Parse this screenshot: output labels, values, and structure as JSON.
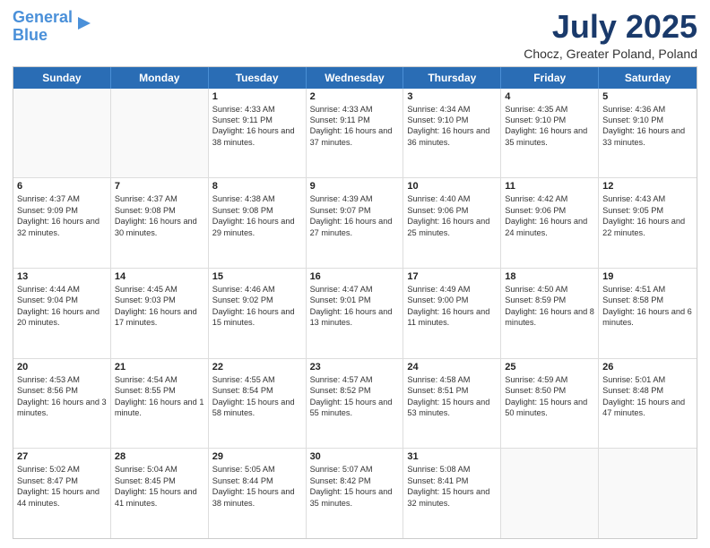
{
  "header": {
    "logo_line1": "General",
    "logo_line2": "Blue",
    "month_year": "July 2025",
    "location": "Chocz, Greater Poland, Poland"
  },
  "weekdays": [
    "Sunday",
    "Monday",
    "Tuesday",
    "Wednesday",
    "Thursday",
    "Friday",
    "Saturday"
  ],
  "rows": [
    [
      {
        "day": "",
        "sunrise": "",
        "sunset": "",
        "daylight": "",
        "empty": true
      },
      {
        "day": "",
        "sunrise": "",
        "sunset": "",
        "daylight": "",
        "empty": true
      },
      {
        "day": "1",
        "sunrise": "Sunrise: 4:33 AM",
        "sunset": "Sunset: 9:11 PM",
        "daylight": "Daylight: 16 hours and 38 minutes."
      },
      {
        "day": "2",
        "sunrise": "Sunrise: 4:33 AM",
        "sunset": "Sunset: 9:11 PM",
        "daylight": "Daylight: 16 hours and 37 minutes."
      },
      {
        "day": "3",
        "sunrise": "Sunrise: 4:34 AM",
        "sunset": "Sunset: 9:10 PM",
        "daylight": "Daylight: 16 hours and 36 minutes."
      },
      {
        "day": "4",
        "sunrise": "Sunrise: 4:35 AM",
        "sunset": "Sunset: 9:10 PM",
        "daylight": "Daylight: 16 hours and 35 minutes."
      },
      {
        "day": "5",
        "sunrise": "Sunrise: 4:36 AM",
        "sunset": "Sunset: 9:10 PM",
        "daylight": "Daylight: 16 hours and 33 minutes."
      }
    ],
    [
      {
        "day": "6",
        "sunrise": "Sunrise: 4:37 AM",
        "sunset": "Sunset: 9:09 PM",
        "daylight": "Daylight: 16 hours and 32 minutes."
      },
      {
        "day": "7",
        "sunrise": "Sunrise: 4:37 AM",
        "sunset": "Sunset: 9:08 PM",
        "daylight": "Daylight: 16 hours and 30 minutes."
      },
      {
        "day": "8",
        "sunrise": "Sunrise: 4:38 AM",
        "sunset": "Sunset: 9:08 PM",
        "daylight": "Daylight: 16 hours and 29 minutes."
      },
      {
        "day": "9",
        "sunrise": "Sunrise: 4:39 AM",
        "sunset": "Sunset: 9:07 PM",
        "daylight": "Daylight: 16 hours and 27 minutes."
      },
      {
        "day": "10",
        "sunrise": "Sunrise: 4:40 AM",
        "sunset": "Sunset: 9:06 PM",
        "daylight": "Daylight: 16 hours and 25 minutes."
      },
      {
        "day": "11",
        "sunrise": "Sunrise: 4:42 AM",
        "sunset": "Sunset: 9:06 PM",
        "daylight": "Daylight: 16 hours and 24 minutes."
      },
      {
        "day": "12",
        "sunrise": "Sunrise: 4:43 AM",
        "sunset": "Sunset: 9:05 PM",
        "daylight": "Daylight: 16 hours and 22 minutes."
      }
    ],
    [
      {
        "day": "13",
        "sunrise": "Sunrise: 4:44 AM",
        "sunset": "Sunset: 9:04 PM",
        "daylight": "Daylight: 16 hours and 20 minutes."
      },
      {
        "day": "14",
        "sunrise": "Sunrise: 4:45 AM",
        "sunset": "Sunset: 9:03 PM",
        "daylight": "Daylight: 16 hours and 17 minutes."
      },
      {
        "day": "15",
        "sunrise": "Sunrise: 4:46 AM",
        "sunset": "Sunset: 9:02 PM",
        "daylight": "Daylight: 16 hours and 15 minutes."
      },
      {
        "day": "16",
        "sunrise": "Sunrise: 4:47 AM",
        "sunset": "Sunset: 9:01 PM",
        "daylight": "Daylight: 16 hours and 13 minutes."
      },
      {
        "day": "17",
        "sunrise": "Sunrise: 4:49 AM",
        "sunset": "Sunset: 9:00 PM",
        "daylight": "Daylight: 16 hours and 11 minutes."
      },
      {
        "day": "18",
        "sunrise": "Sunrise: 4:50 AM",
        "sunset": "Sunset: 8:59 PM",
        "daylight": "Daylight: 16 hours and 8 minutes."
      },
      {
        "day": "19",
        "sunrise": "Sunrise: 4:51 AM",
        "sunset": "Sunset: 8:58 PM",
        "daylight": "Daylight: 16 hours and 6 minutes."
      }
    ],
    [
      {
        "day": "20",
        "sunrise": "Sunrise: 4:53 AM",
        "sunset": "Sunset: 8:56 PM",
        "daylight": "Daylight: 16 hours and 3 minutes."
      },
      {
        "day": "21",
        "sunrise": "Sunrise: 4:54 AM",
        "sunset": "Sunset: 8:55 PM",
        "daylight": "Daylight: 16 hours and 1 minute."
      },
      {
        "day": "22",
        "sunrise": "Sunrise: 4:55 AM",
        "sunset": "Sunset: 8:54 PM",
        "daylight": "Daylight: 15 hours and 58 minutes."
      },
      {
        "day": "23",
        "sunrise": "Sunrise: 4:57 AM",
        "sunset": "Sunset: 8:52 PM",
        "daylight": "Daylight: 15 hours and 55 minutes."
      },
      {
        "day": "24",
        "sunrise": "Sunrise: 4:58 AM",
        "sunset": "Sunset: 8:51 PM",
        "daylight": "Daylight: 15 hours and 53 minutes."
      },
      {
        "day": "25",
        "sunrise": "Sunrise: 4:59 AM",
        "sunset": "Sunset: 8:50 PM",
        "daylight": "Daylight: 15 hours and 50 minutes."
      },
      {
        "day": "26",
        "sunrise": "Sunrise: 5:01 AM",
        "sunset": "Sunset: 8:48 PM",
        "daylight": "Daylight: 15 hours and 47 minutes."
      }
    ],
    [
      {
        "day": "27",
        "sunrise": "Sunrise: 5:02 AM",
        "sunset": "Sunset: 8:47 PM",
        "daylight": "Daylight: 15 hours and 44 minutes."
      },
      {
        "day": "28",
        "sunrise": "Sunrise: 5:04 AM",
        "sunset": "Sunset: 8:45 PM",
        "daylight": "Daylight: 15 hours and 41 minutes."
      },
      {
        "day": "29",
        "sunrise": "Sunrise: 5:05 AM",
        "sunset": "Sunset: 8:44 PM",
        "daylight": "Daylight: 15 hours and 38 minutes."
      },
      {
        "day": "30",
        "sunrise": "Sunrise: 5:07 AM",
        "sunset": "Sunset: 8:42 PM",
        "daylight": "Daylight: 15 hours and 35 minutes."
      },
      {
        "day": "31",
        "sunrise": "Sunrise: 5:08 AM",
        "sunset": "Sunset: 8:41 PM",
        "daylight": "Daylight: 15 hours and 32 minutes."
      },
      {
        "day": "",
        "sunrise": "",
        "sunset": "",
        "daylight": "",
        "empty": true
      },
      {
        "day": "",
        "sunrise": "",
        "sunset": "",
        "daylight": "",
        "empty": true
      }
    ]
  ]
}
